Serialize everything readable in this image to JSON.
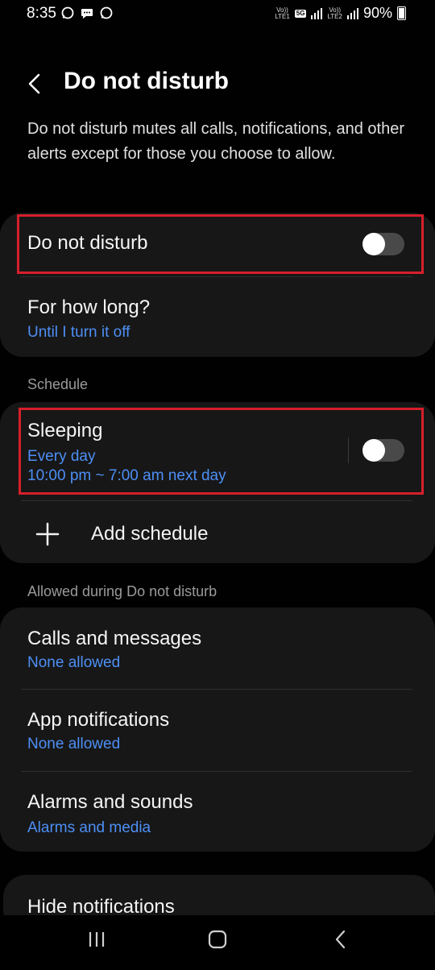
{
  "status_bar": {
    "time": "8:35",
    "app_icons": [
      "whatsapp-icon",
      "messages-icon",
      "whatsapp-icon"
    ],
    "sim1_label": "Vo))\nLTE1",
    "network_label": "5G",
    "sim2_label": "Vo))\nLTE2",
    "battery": "90%"
  },
  "header": {
    "title": "Do not disturb"
  },
  "description": "Do not disturb mutes all calls, notifications, and other alerts except for those you choose to allow.",
  "main_card": {
    "dnd_label": "Do not disturb",
    "dnd_on": false,
    "duration_title": "For how long?",
    "duration_value": "Until I turn it off"
  },
  "schedule": {
    "section_label": "Schedule",
    "sleeping_title": "Sleeping",
    "sleeping_days": "Every day",
    "sleeping_time": "10:00 pm ~ 7:00 am next day",
    "sleeping_on": false,
    "add_label": "Add schedule"
  },
  "allowed": {
    "section_label": "Allowed during Do not disturb",
    "items": [
      {
        "title": "Calls and messages",
        "value": "None allowed"
      },
      {
        "title": "App notifications",
        "value": "None allowed"
      },
      {
        "title": "Alarms and sounds",
        "value": "Alarms and media"
      }
    ]
  },
  "hide": {
    "title": "Hide notifications"
  },
  "colors": {
    "accent": "#4d8ff5",
    "highlight": "#d61f2b",
    "card": "#171717",
    "background": "#010101"
  }
}
